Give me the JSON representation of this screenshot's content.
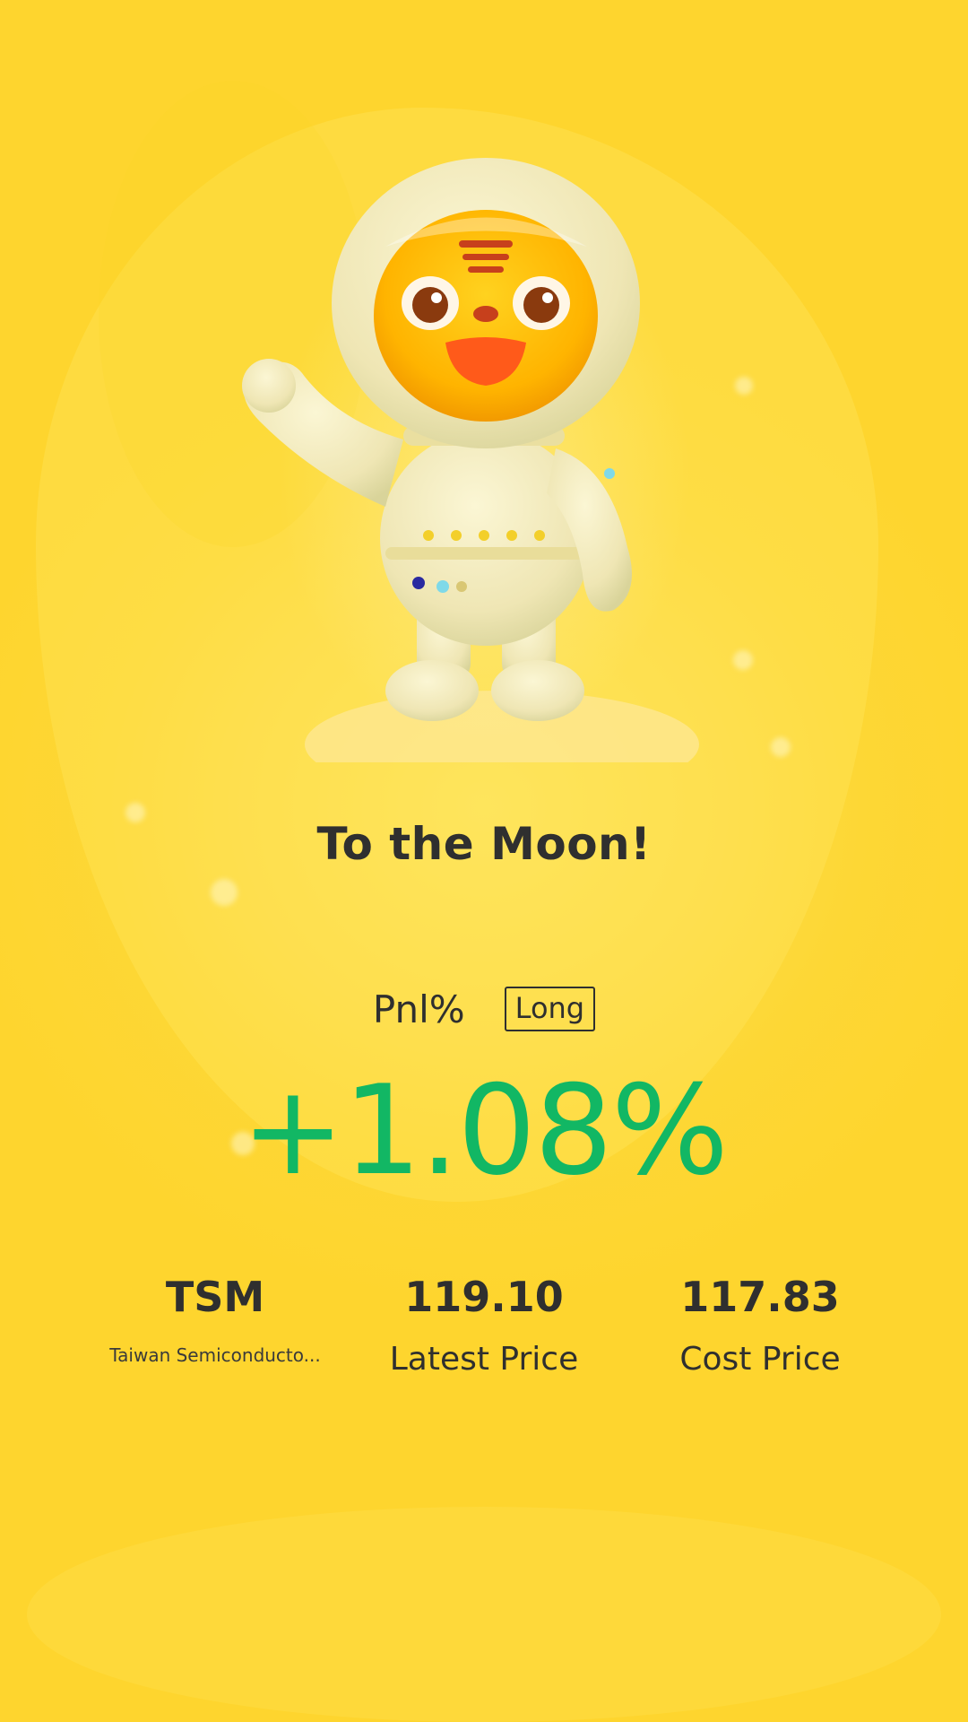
{
  "headline": "To the Moon!",
  "pnl": {
    "label": "Pnl%",
    "position_badge": "Long",
    "value": "+1.08%",
    "color": "#12b764"
  },
  "stock": {
    "symbol": "TSM",
    "name": "Taiwan Semiconducto..."
  },
  "latest_price": {
    "value": "119.10",
    "label": "Latest Price"
  },
  "cost_price": {
    "value": "117.83",
    "label": "Cost Price"
  },
  "illustration": {
    "icon": "tiger-astronaut-mascot-icon"
  },
  "colors": {
    "background": "#fdd835",
    "text": "#2f2f2f",
    "positive": "#12b764"
  }
}
